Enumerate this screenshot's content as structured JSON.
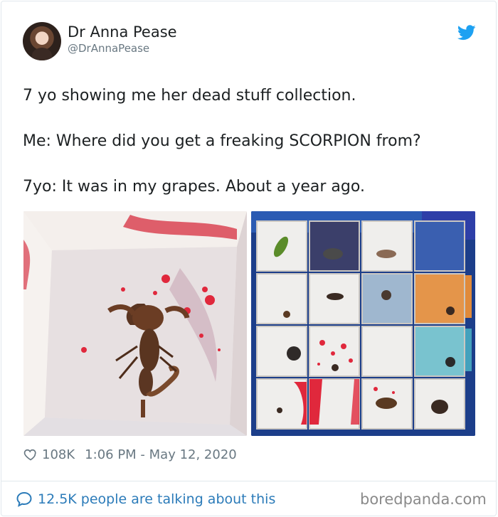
{
  "tweet": {
    "author_name": "Dr Anna Pease",
    "author_handle": "@DrAnnaPease",
    "text_lines": [
      "7 yo showing me her dead stuff collection.",
      "Me: Where did you get a freaking SCORPION from?",
      "7yo: It was in my grapes. About a year ago."
    ],
    "likes": "108K",
    "timestamp": "1:06 PM - May 12, 2020",
    "conversation_link": "12.5K people are talking about this"
  },
  "icons": {
    "twitter": "twitter-bird-icon",
    "like": "heart-icon",
    "reply": "speech-bubble-icon"
  },
  "colors": {
    "twitter_blue": "#1da1f2",
    "link_blue": "#2b7bb9",
    "muted_gray": "#697882"
  },
  "watermark": "boredpanda.com"
}
